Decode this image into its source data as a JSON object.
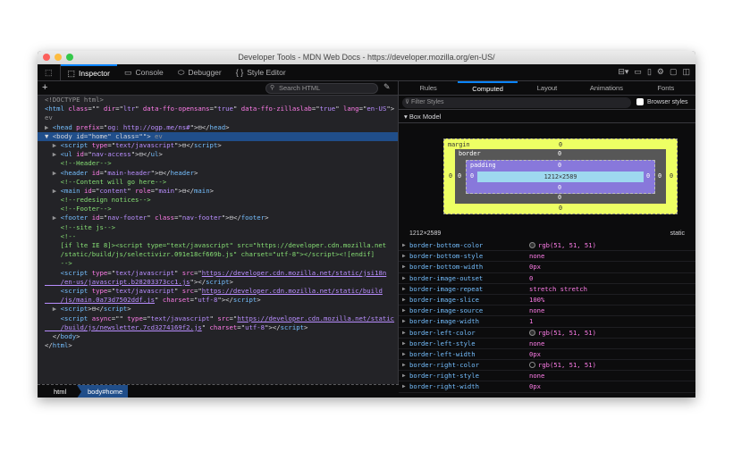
{
  "window": {
    "title": "Developer Tools - MDN Web Docs - https://developer.mozilla.org/en-US/"
  },
  "toolbar": {
    "tabs": [
      {
        "label": "Inspector",
        "icon": "inspector-icon"
      },
      {
        "label": "Console",
        "icon": "console-icon"
      },
      {
        "label": "Debugger",
        "icon": "debugger-icon"
      },
      {
        "label": "Style Editor",
        "icon": "{ }"
      }
    ],
    "selected": "Inspector"
  },
  "inspector": {
    "search_placeholder": "Search HTML",
    "lines": [
      [
        [
          "ex",
          "<!DOCTYPE html>"
        ]
      ],
      [
        [
          "tg",
          "<html "
        ],
        [
          "at",
          "class"
        ],
        [
          "tx",
          "=\""
        ],
        [
          "av",
          ""
        ],
        [
          "tx",
          "\" "
        ],
        [
          "at",
          "dir"
        ],
        [
          "tx",
          "=\""
        ],
        [
          "av",
          "ltr"
        ],
        [
          "tx",
          "\" "
        ],
        [
          "at",
          "data-ffo-opensans"
        ],
        [
          "tx",
          "=\""
        ],
        [
          "av",
          "true"
        ],
        [
          "tx",
          "\" "
        ],
        [
          "at",
          "data-ffo-zillaslab"
        ],
        [
          "tx",
          "=\""
        ],
        [
          "av",
          "true"
        ],
        [
          "tx",
          "\" "
        ],
        [
          "at",
          "lang"
        ],
        [
          "tx",
          "=\""
        ],
        [
          "av",
          "en-US"
        ],
        [
          "tx",
          "\">"
        ]
      ],
      [
        [
          "ex",
          "ev"
        ]
      ],
      [
        [
          "ex",
          "▶ "
        ],
        [
          "tg",
          "<head "
        ],
        [
          "at",
          "prefix"
        ],
        [
          "tx",
          "=\""
        ],
        [
          "av",
          "og: http://ogp.me/ns#"
        ],
        [
          "tx",
          "\">⊟</"
        ],
        [
          "tg",
          "head"
        ],
        [
          "tx",
          ">"
        ]
      ],
      [
        [
          "tx",
          "▼ <body id=\"home\" class=\"\"> "
        ],
        [
          "ex",
          "ev"
        ]
      ],
      [
        [
          "ex",
          "  ▶ "
        ],
        [
          "tg",
          "<script "
        ],
        [
          "at",
          "type"
        ],
        [
          "tx",
          "=\""
        ],
        [
          "av",
          "text/javascript"
        ],
        [
          "tx",
          "\">⊟</"
        ],
        [
          "tg",
          "script"
        ],
        [
          "tx",
          ">"
        ]
      ],
      [
        [
          "ex",
          "  ▶ "
        ],
        [
          "tg",
          "<ul "
        ],
        [
          "at",
          "id"
        ],
        [
          "tx",
          "=\""
        ],
        [
          "av",
          "nav-access"
        ],
        [
          "tx",
          "\">⊟</"
        ],
        [
          "tg",
          "ul"
        ],
        [
          "tx",
          ">"
        ]
      ],
      [
        [
          "cm",
          "    <!--Header-->"
        ]
      ],
      [
        [
          "ex",
          "  ▶ "
        ],
        [
          "tg",
          "<header "
        ],
        [
          "at",
          "id"
        ],
        [
          "tx",
          "=\""
        ],
        [
          "av",
          "main-header"
        ],
        [
          "tx",
          "\">⊟</"
        ],
        [
          "tg",
          "header"
        ],
        [
          "tx",
          ">"
        ]
      ],
      [
        [
          "cm",
          "    <!--Content will go here-->"
        ]
      ],
      [
        [
          "ex",
          "  ▶ "
        ],
        [
          "tg",
          "<main "
        ],
        [
          "at",
          "id"
        ],
        [
          "tx",
          "=\""
        ],
        [
          "av",
          "content"
        ],
        [
          "tx",
          "\" "
        ],
        [
          "at",
          "role"
        ],
        [
          "tx",
          "=\""
        ],
        [
          "av",
          "main"
        ],
        [
          "tx",
          "\">⊟</"
        ],
        [
          "tg",
          "main"
        ],
        [
          "tx",
          ">"
        ]
      ],
      [
        [
          "cm",
          "    <!--redesign notices-->"
        ]
      ],
      [
        [
          "cm",
          "    <!--Footer-->"
        ]
      ],
      [
        [
          "ex",
          "  ▶ "
        ],
        [
          "tg",
          "<footer "
        ],
        [
          "at",
          "id"
        ],
        [
          "tx",
          "=\""
        ],
        [
          "av",
          "nav-footer"
        ],
        [
          "tx",
          "\" "
        ],
        [
          "at",
          "class"
        ],
        [
          "tx",
          "=\""
        ],
        [
          "av",
          "nav-footer"
        ],
        [
          "tx",
          "\">⊟</"
        ],
        [
          "tg",
          "footer"
        ],
        [
          "tx",
          ">"
        ]
      ],
      [
        [
          "cm",
          "    <!--site js-->"
        ]
      ],
      [
        [
          "cm",
          "    <!--"
        ]
      ],
      [
        [
          "cm",
          "    [if lte IE 8]><script type=\"text/javascript\" src=\"https://developer.cdn.mozilla.net"
        ]
      ],
      [
        [
          "cm",
          "    /static/build/js/selectivizr.091e18cf669b.js\" charset=\"utf-8\"></script><![endif]"
        ]
      ],
      [
        [
          "cm",
          "    -->"
        ]
      ],
      [
        [
          "tg",
          "    <script "
        ],
        [
          "at",
          "type"
        ],
        [
          "tx",
          "=\""
        ],
        [
          "av",
          "text/javascript"
        ],
        [
          "tx",
          "\" "
        ],
        [
          "at",
          "src"
        ],
        [
          "tx",
          "=\""
        ],
        [
          "lk",
          "https://developer.cdn.mozilla.net/static/jsi18n"
        ]
      ],
      [
        [
          "lk",
          "    /en-us/javascript.b28203373cc1.js"
        ],
        [
          "tx",
          "\"></"
        ],
        [
          "tg",
          "script"
        ],
        [
          "tx",
          ">"
        ]
      ],
      [
        [
          "tg",
          "    <script "
        ],
        [
          "at",
          "type"
        ],
        [
          "tx",
          "=\""
        ],
        [
          "av",
          "text/javascript"
        ],
        [
          "tx",
          "\" "
        ],
        [
          "at",
          "src"
        ],
        [
          "tx",
          "=\""
        ],
        [
          "lk",
          "https://developer.cdn.mozilla.net/static/build"
        ]
      ],
      [
        [
          "lk",
          "    /js/main.0a73d7502ddf.js"
        ],
        [
          "tx",
          "\" "
        ],
        [
          "at",
          "charset"
        ],
        [
          "tx",
          "=\""
        ],
        [
          "av",
          "utf-8"
        ],
        [
          "tx",
          "\"></"
        ],
        [
          "tg",
          "script"
        ],
        [
          "tx",
          ">"
        ]
      ],
      [
        [
          "ex",
          "  ▶ "
        ],
        [
          "tg",
          "<script"
        ],
        [
          "tx",
          ">⊟</"
        ],
        [
          "tg",
          "script"
        ],
        [
          "tx",
          ">"
        ]
      ],
      [
        [
          "tg",
          "    <script "
        ],
        [
          "at",
          "async"
        ],
        [
          "tx",
          "=\"\" "
        ],
        [
          "at",
          "type"
        ],
        [
          "tx",
          "=\""
        ],
        [
          "av",
          "text/javascript"
        ],
        [
          "tx",
          "\" "
        ],
        [
          "at",
          "src"
        ],
        [
          "tx",
          "=\""
        ],
        [
          "lk",
          "https://developer.cdn.mozilla.net/static"
        ]
      ],
      [
        [
          "lk",
          "    /build/js/newsletter.7cd3274169f2.js"
        ],
        [
          "tx",
          "\" "
        ],
        [
          "at",
          "charset"
        ],
        [
          "tx",
          "=\""
        ],
        [
          "av",
          "utf-8"
        ],
        [
          "tx",
          "\"></"
        ],
        [
          "tg",
          "script"
        ],
        [
          "tx",
          ">"
        ]
      ],
      [
        [
          "tx",
          "  </"
        ],
        [
          "tg",
          "body"
        ],
        [
          "tx",
          ">"
        ]
      ],
      [
        [
          "tx",
          "</"
        ],
        [
          "tg",
          "html"
        ],
        [
          "tx",
          ">"
        ]
      ]
    ],
    "selected_line": 4,
    "breadcrumbs": [
      "html",
      "body#home"
    ]
  },
  "sidebar": {
    "tabs": [
      "Rules",
      "Computed",
      "Layout",
      "Animations",
      "Fonts"
    ],
    "selected": "Computed",
    "filter_placeholder": "Filter Styles",
    "browser_styles_label": "Browser styles",
    "browser_styles_checked": false,
    "box_model": {
      "header": "Box Model",
      "margin_label": "margin",
      "border_label": "border",
      "padding_label": "padding",
      "margin": {
        "top": "0",
        "right": "0",
        "bottom": "0",
        "left": "0"
      },
      "border": {
        "top": "0",
        "right": "0",
        "bottom": "0",
        "left": "0"
      },
      "padding": {
        "top": "0",
        "right": "0",
        "bottom": "0",
        "left": "0"
      },
      "content": "1212×2589",
      "size": "1212×2589",
      "position": "static"
    },
    "properties": [
      {
        "name": "border-bottom-color",
        "value": "rgb(51, 51, 51)",
        "swatch": "#333333"
      },
      {
        "name": "border-bottom-style",
        "value": "none"
      },
      {
        "name": "border-bottom-width",
        "value": "0px"
      },
      {
        "name": "border-image-outset",
        "value": "0"
      },
      {
        "name": "border-image-repeat",
        "value": "stretch stretch"
      },
      {
        "name": "border-image-slice",
        "value": "100%"
      },
      {
        "name": "border-image-source",
        "value": "none"
      },
      {
        "name": "border-image-width",
        "value": "1"
      },
      {
        "name": "border-left-color",
        "value": "rgb(51, 51, 51)",
        "swatch": "#333333"
      },
      {
        "name": "border-left-style",
        "value": "none"
      },
      {
        "name": "border-left-width",
        "value": "0px"
      },
      {
        "name": "border-right-color",
        "value": "rgb(51, 51, 51)",
        "swatch": "#333333"
      },
      {
        "name": "border-right-style",
        "value": "none"
      },
      {
        "name": "border-right-width",
        "value": "0px"
      }
    ]
  },
  "colors": {
    "accent": "#0a84ff",
    "selection": "#204e8a",
    "margin": "#edff64",
    "border": "#575757",
    "padding": "#8878db",
    "content": "#9ed8ef"
  }
}
